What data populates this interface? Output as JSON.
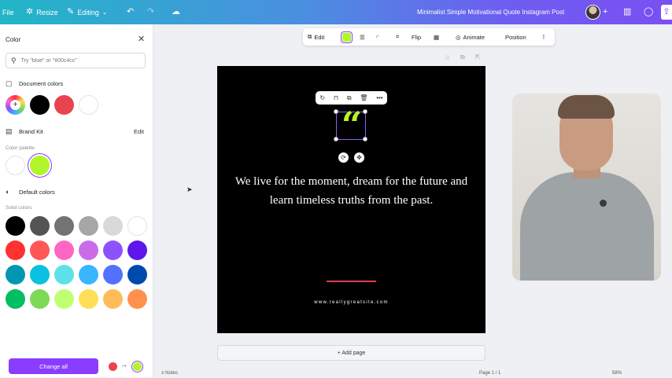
{
  "topbar": {
    "file_label": "File",
    "resize_label": "Resize",
    "editing_label": "Editing",
    "design_title": "Minimalist Simple Motivational Quote Instagram Post"
  },
  "sidebar": {
    "title": "Color",
    "search_placeholder": "Try \"blue\" or \"#00c4cc\"",
    "document_colors": {
      "label": "Document colors",
      "swatches": [
        "rainbow-add",
        "#000000",
        "#e8434f",
        "#ffffff"
      ]
    },
    "brand_kit": {
      "label": "Brand Kit",
      "edit_label": "Edit",
      "palette_label": "Color palette",
      "swatches": [
        "#ffffff",
        "#b2f52a"
      ]
    },
    "default_colors": {
      "label": "Default colors",
      "solid_label": "Solid colors",
      "rows": [
        [
          "#000000",
          "#545454",
          "#737373",
          "#a6a6a6",
          "#d9d9d9",
          "#ffffff"
        ],
        [
          "#ff3131",
          "#ff5757",
          "#ff66c4",
          "#cb6ce6",
          "#8c52ff",
          "#5e17eb"
        ],
        [
          "#0097b2",
          "#0cc0df",
          "#5ce1e6",
          "#38b6ff",
          "#5271ff",
          "#004aad"
        ],
        [
          "#00bf63",
          "#7ed957",
          "#c1ff72",
          "#ffde59",
          "#ffbd59",
          "#ff914d"
        ]
      ]
    },
    "change_all_label": "Change all",
    "change_from": "#e8434f",
    "change_to": "#b2f52a"
  },
  "toolbar": {
    "edit_label": "Edit",
    "selected_color": "#b2f52a",
    "flip_label": "Flip",
    "animate_label": "Animate",
    "position_label": "Position"
  },
  "canvas": {
    "quote": "We live for the moment, dream for the future and learn timeless truths from the past.",
    "website": "www.reallygreatsite.com",
    "quote_mark": "“",
    "accent_color": "#e0404d"
  },
  "add_page_label": "+ Add page",
  "footer": {
    "notes_label": "Notes",
    "page_label": "Page 1 / 1",
    "zoom_label": "58%"
  }
}
